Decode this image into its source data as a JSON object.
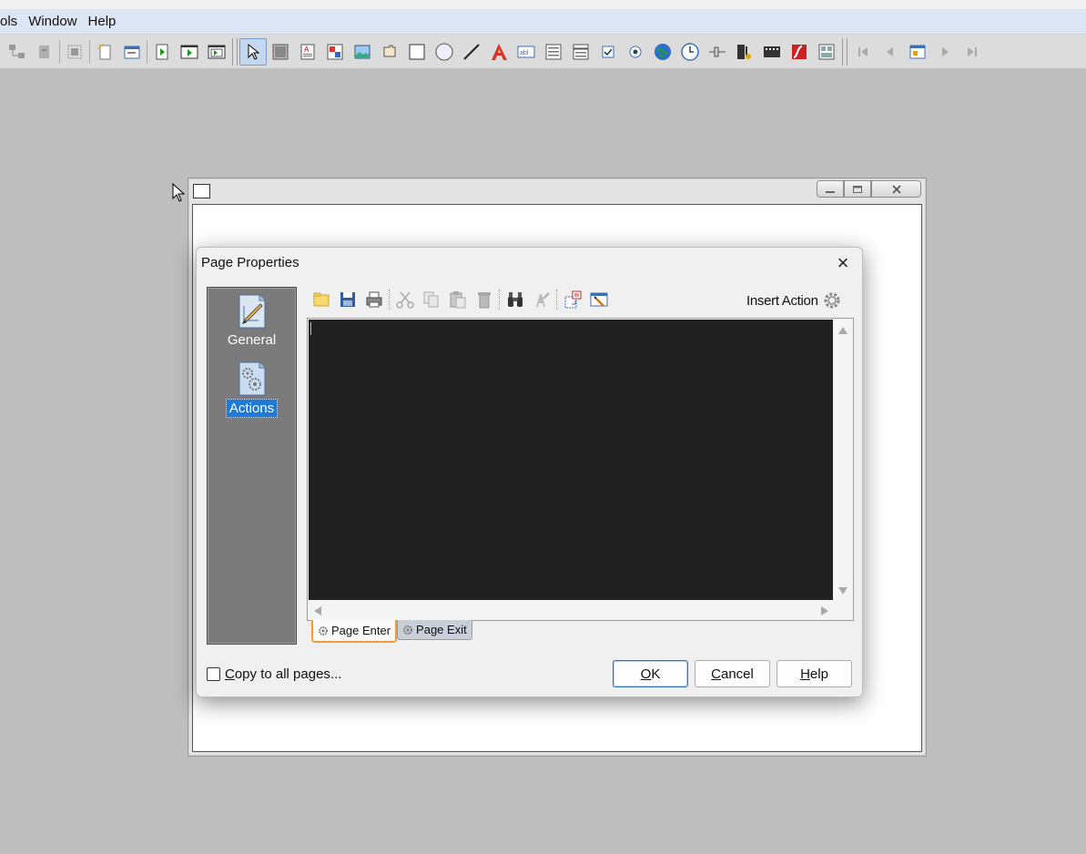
{
  "menu": [
    "ols",
    "Window",
    "Help"
  ],
  "toolbar_icons": [
    "group-icon",
    "object-icon",
    "align-icon",
    "new-page-icon",
    "page-icon",
    "play-icon",
    "preview-icon",
    "preview-page-icon",
    "pointer-icon",
    "button-icon",
    "label-icon",
    "image-icon",
    "picture-icon",
    "hotspot-icon",
    "rectangle-icon",
    "ellipse-icon",
    "line-icon",
    "text-icon",
    "input-icon",
    "listbox-icon",
    "combobox-icon",
    "checkbox-icon",
    "radio-icon",
    "web-icon",
    "timer-icon",
    "slider-icon",
    "video-icon",
    "media-icon",
    "flash-icon",
    "grid-icon",
    "first-page-icon",
    "prev-page-icon",
    "page-list-icon",
    "next-page-icon",
    "last-page-icon"
  ],
  "dialog": {
    "title": "Page Properties",
    "close": "×",
    "side_items": [
      {
        "label": "General",
        "icon": "general-icon"
      },
      {
        "label": "Actions",
        "icon": "actions-icon",
        "selected": true
      }
    ],
    "insert_action": "Insert Action",
    "editor_content": "",
    "tabs": [
      {
        "label": "Page Enter",
        "active": true
      },
      {
        "label": "Page Exit",
        "active": false
      }
    ],
    "copy_to_all": {
      "pre": "",
      "underline": "C",
      "post": "opy to all pages...",
      "checked": false
    },
    "buttons": {
      "ok": {
        "underline": "O",
        "rest": "K"
      },
      "cancel": {
        "underline": "C",
        "rest": "ancel"
      },
      "help": {
        "underline": "H",
        "rest": "elp"
      }
    }
  },
  "colors": {
    "selection": "#1e7ad6",
    "editor_bg": "#212121",
    "active_tab_accent": "#f29b3b",
    "desktop": "#bebebe"
  }
}
